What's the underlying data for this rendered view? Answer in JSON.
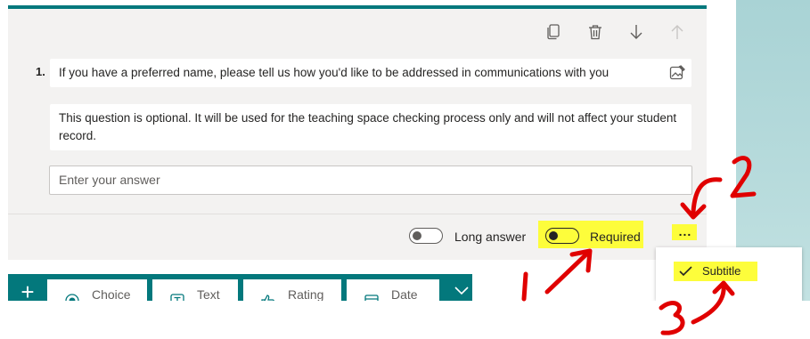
{
  "question": {
    "number": "1.",
    "title": "If you have a preferred name, please tell us how you'd like to be addressed in communications with you",
    "subtitle": "This question is optional. It will be used for the teaching space checking process only and will not affect your student record.",
    "answer_placeholder": "Enter your answer"
  },
  "toolbar": {
    "icons": [
      "copy-icon",
      "delete-icon",
      "move-down-icon",
      "move-up-icon"
    ]
  },
  "footer": {
    "long_answer_label": "Long answer",
    "required_label": "Required",
    "more_label": "..."
  },
  "more_menu": {
    "items": [
      {
        "label": "Subtitle",
        "checked": true
      }
    ]
  },
  "add_bar": {
    "plus_label": "+",
    "buttons": [
      "Choice",
      "Text",
      "Rating",
      "Date"
    ]
  },
  "annotations": {
    "labels": [
      "1",
      "2",
      "3"
    ],
    "color": "#e00000",
    "highlight_color": "#fdfd3b"
  },
  "colors": {
    "accent": "#03787c",
    "card_bg": "#f3f2f1"
  }
}
